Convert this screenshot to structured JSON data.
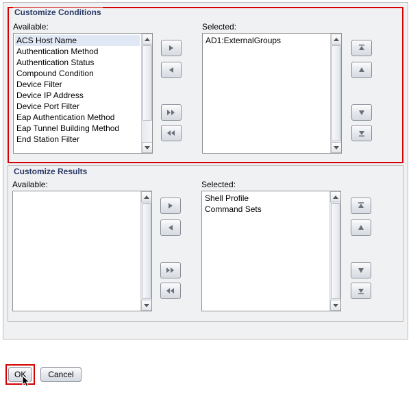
{
  "conditions": {
    "title": "Customize Conditions",
    "available_label": "Available:",
    "selected_label": "Selected:",
    "available": [
      "ACS Host Name",
      "Authentication Method",
      "Authentication Status",
      "Compound Condition",
      "Device Filter",
      "Device IP Address",
      "Device Port Filter",
      "Eap Authentication Method",
      "Eap Tunnel Building Method",
      "End Station Filter"
    ],
    "available_selected_index": 0,
    "selected": [
      "AD1:ExternalGroups"
    ]
  },
  "results": {
    "title": "Customize Results",
    "available_label": "Available:",
    "selected_label": "Selected:",
    "available": [],
    "selected": [
      "Shell Profile",
      "Command Sets"
    ]
  },
  "buttons": {
    "ok": "OK",
    "cancel": "Cancel"
  },
  "colors": {
    "highlight_border": "#d60000",
    "section_title": "#2a3a66"
  }
}
